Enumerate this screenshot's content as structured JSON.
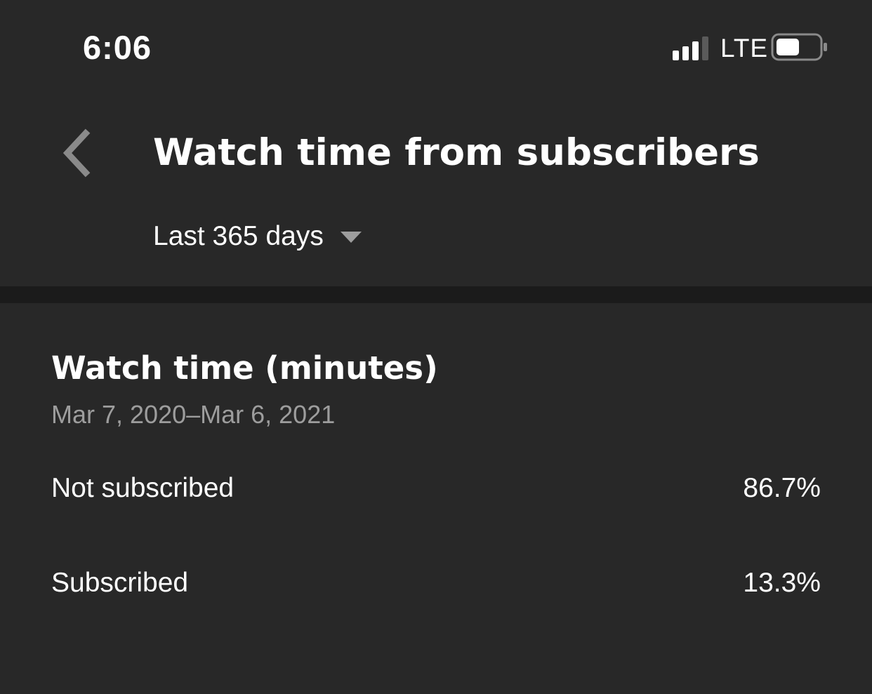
{
  "status_bar": {
    "time": "6:06",
    "network": "LTE",
    "signal_bars": 3,
    "signal_bars_total": 4,
    "battery_level": 0.55
  },
  "header": {
    "title": "Watch time from subscribers",
    "period": "Last 365 days"
  },
  "card": {
    "title": "Watch time (minutes)",
    "date_range": "Mar 7, 2020–Mar 6, 2021",
    "rows": [
      {
        "label": "Not subscribed",
        "value": "86.7%"
      },
      {
        "label": "Subscribed",
        "value": "13.3%"
      }
    ]
  },
  "colors": {
    "background": "#282828",
    "divider": "#1b1b1b",
    "text_primary": "#ffffff",
    "text_secondary": "#9d9d9d",
    "icon_muted": "#8a8a8a"
  },
  "icons": {
    "back": "chevron-left-icon",
    "dropdown": "caret-down-icon",
    "signal": "cellular-signal-icon",
    "battery": "battery-icon"
  }
}
